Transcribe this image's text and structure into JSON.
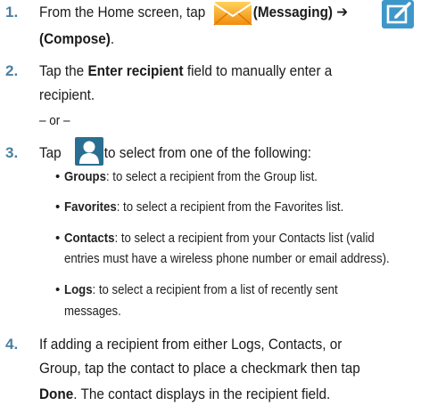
{
  "step1": {
    "number": "1.",
    "text_a": "From the Home screen, tap",
    "messaging_label": "(Messaging)",
    "arrow": "➔",
    "compose_label": "(Compose)",
    "period": "."
  },
  "step2": {
    "number": "2.",
    "line1_a": "Tap the",
    "line1_b": "Enter recipient",
    "line1_c": "field to manually enter a",
    "line2": "recipient.",
    "or": "– or –"
  },
  "step3": {
    "number": "3.",
    "text_a": "Tap",
    "text_b": "to select from one of the following:",
    "items": [
      {
        "bullet": "•",
        "term": "Groups",
        "lines": [
          ": to select a recipient from the Group list."
        ]
      },
      {
        "bullet": "•",
        "term": "Favorites",
        "lines": [
          ": to select a recipient from the Favorites list."
        ]
      },
      {
        "bullet": "•",
        "term": "Contacts",
        "lines": [
          ": to select a recipient from your Contacts list (valid",
          "entries must have a wireless phone number or email address)."
        ]
      },
      {
        "bullet": "•",
        "term": "Logs",
        "lines": [
          ": to select a recipient from a list of recently sent",
          "messages."
        ]
      }
    ]
  },
  "step4": {
    "number": "4.",
    "line1": "If adding a recipient from either Logs, Contacts, or",
    "line2": "Group, tap the contact to place a checkmark then tap",
    "line3_b": "Done",
    "line3_rest": ". The contact displays in the recipient field."
  },
  "colors": {
    "heading": "#2f6f8c",
    "step_number": "#4a7fa2",
    "messaging_icon": "#f5a31a",
    "compose_icon": "#3e97c9",
    "contact_icon": "#2a6f92"
  }
}
